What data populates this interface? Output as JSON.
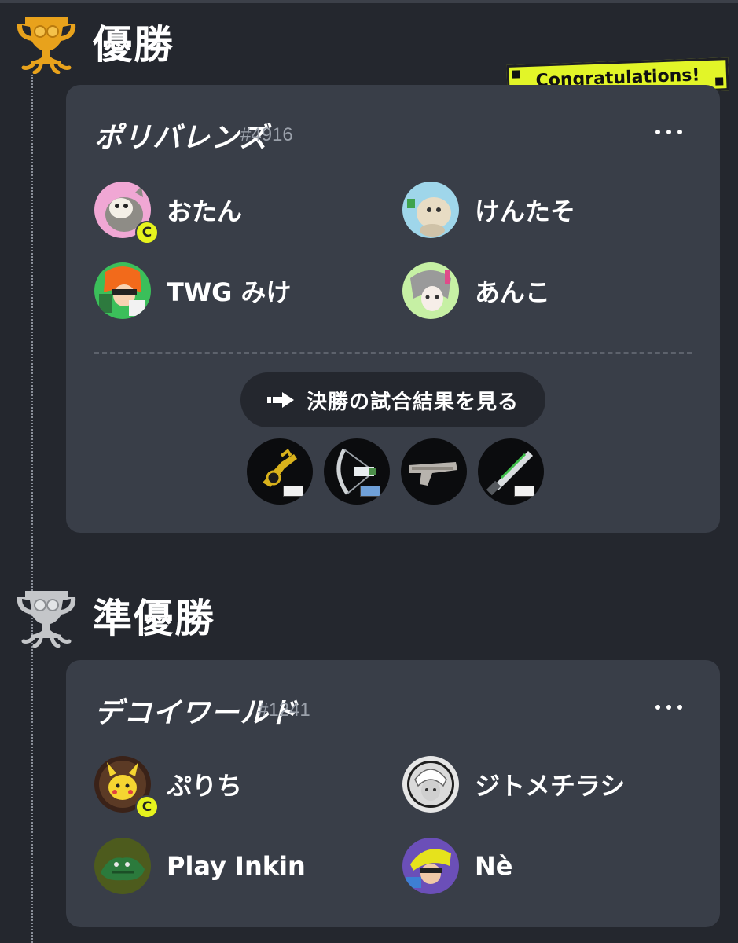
{
  "sections": [
    {
      "title": "優勝",
      "banner": "Congratulations!",
      "team": {
        "name": "ポリバレンズ",
        "id": "#4916",
        "members": [
          {
            "name": "おたん",
            "captain": true,
            "captain_mark": "C"
          },
          {
            "name": "けんたそ",
            "captain": false
          },
          {
            "name": "TWG みけ",
            "captain": false
          },
          {
            "name": "あんこ",
            "captain": false
          }
        ],
        "results_button": "決勝の試合結果を見る"
      }
    },
    {
      "title": "準優勝",
      "team": {
        "name": "デコイワールド",
        "id": "#1241",
        "members": [
          {
            "name": "ぷりち",
            "captain": true,
            "captain_mark": "C"
          },
          {
            "name": "ジトメチラシ",
            "captain": false
          },
          {
            "name": "Play Inkin",
            "captain": false
          },
          {
            "name": "Nè",
            "captain": false
          }
        ]
      }
    }
  ],
  "icons": {
    "trophy_gold": "trophy-gold-icon",
    "trophy_silver": "trophy-silver-icon",
    "more": "more-dots-icon",
    "arrow": "arrow-right-icon",
    "weapons": [
      "splatling-weapon-icon",
      "stringer-weapon-icon",
      "blaster-weapon-icon",
      "splatana-weapon-icon"
    ]
  },
  "colors": {
    "background": "#24272e",
    "card": "#393e48",
    "accent_yellow": "#e2f528",
    "gold": "#e8a21c",
    "silver": "#c4c6c9"
  }
}
